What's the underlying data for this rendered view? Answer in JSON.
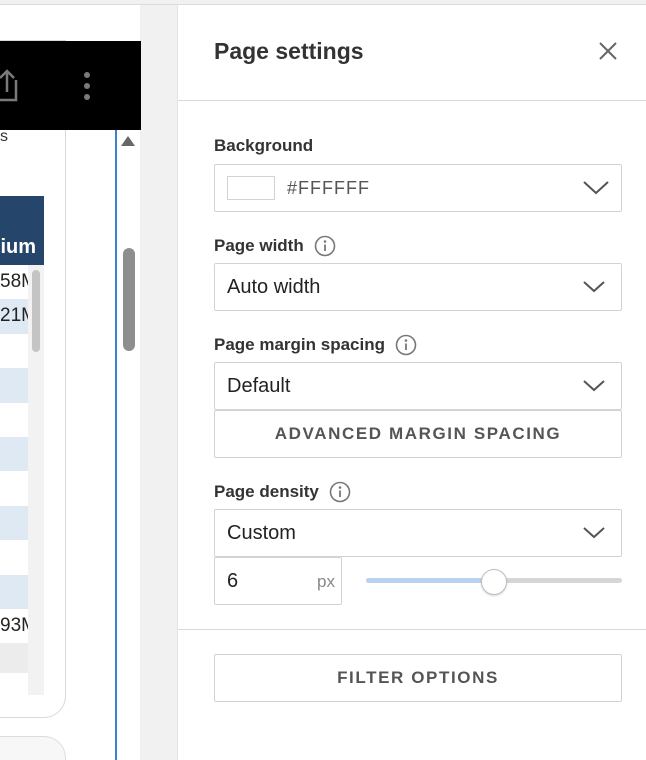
{
  "report_preview": {
    "cut_text": "s",
    "table_header": "ium",
    "rows": [
      "58M",
      "21M",
      "",
      "",
      "",
      "",
      "",
      "",
      "",
      "",
      "93M"
    ]
  },
  "panel": {
    "title": "Page settings",
    "background": {
      "label": "Background",
      "value": "#FFFFFF",
      "swatch_color": "#FFFFFF"
    },
    "page_width": {
      "label": "Page width",
      "value": "Auto width"
    },
    "margin_spacing": {
      "label": "Page margin spacing",
      "value": "Default",
      "advanced_button": "ADVANCED MARGIN SPACING"
    },
    "density": {
      "label": "Page density",
      "value": "Custom",
      "px_value": "6",
      "px_unit": "px",
      "slider_level": 0.5
    },
    "filter_button": "FILTER OPTIONS"
  },
  "colors": {
    "table_header": "#26456b",
    "row_alt": "#dfe9f3",
    "accent_line": "#3e82c8",
    "slider_fill": "#b7d3ee"
  },
  "icons": [
    "share-icon",
    "more-vertical-icon",
    "close-icon",
    "info-icon",
    "chevron-down-icon"
  ]
}
